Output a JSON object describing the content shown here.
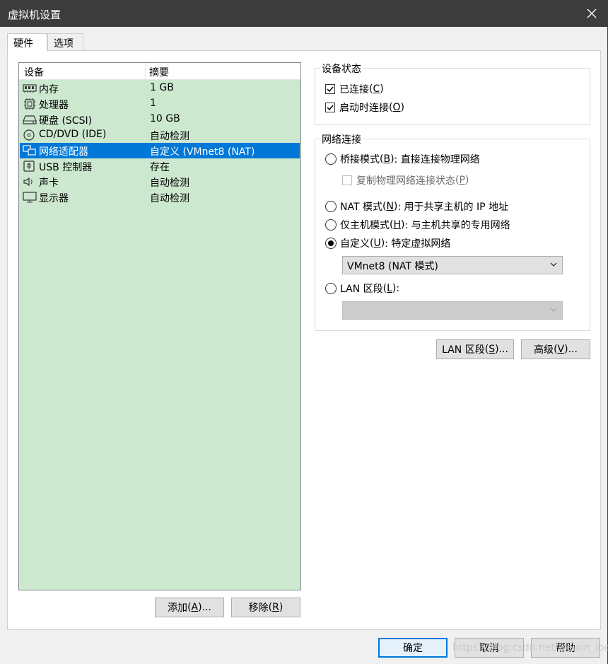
{
  "window": {
    "title": "虚拟机设置"
  },
  "tabs": [
    {
      "label": "硬件",
      "active": true
    },
    {
      "label": "选项",
      "active": false
    }
  ],
  "device_list": {
    "columns": [
      "设备",
      "摘要"
    ],
    "rows": [
      {
        "icon": "memory-icon",
        "name": "内存",
        "summary": "1 GB",
        "selected": false
      },
      {
        "icon": "processor-icon",
        "name": "处理器",
        "summary": "1",
        "selected": false
      },
      {
        "icon": "hard-disk-icon",
        "name": "硬盘 (SCSI)",
        "summary": "10 GB",
        "selected": false
      },
      {
        "icon": "cd-dvd-icon",
        "name": "CD/DVD (IDE)",
        "summary": "自动检测",
        "selected": false
      },
      {
        "icon": "network-adapter-icon",
        "name": "网络适配器",
        "summary": "自定义 (VMnet8 (NAT)",
        "selected": true
      },
      {
        "icon": "usb-icon",
        "name": "USB 控制器",
        "summary": "存在",
        "selected": false
      },
      {
        "icon": "sound-icon",
        "name": "声卡",
        "summary": "自动检测",
        "selected": false
      },
      {
        "icon": "display-icon",
        "name": "显示器",
        "summary": "自动检测",
        "selected": false
      }
    ],
    "add_button": {
      "label": "添加",
      "key": "A",
      "suffix": "..."
    },
    "remove_button": {
      "label": "移除",
      "key": "R",
      "suffix": ""
    }
  },
  "device_status": {
    "title": "设备状态",
    "connected": {
      "label": "已连接",
      "key": "C",
      "checked": true
    },
    "connect_at_power_on": {
      "label": "启动时连接",
      "key": "O",
      "checked": true
    }
  },
  "network_connection": {
    "title": "网络连接",
    "bridged": {
      "label": "桥接模式",
      "key": "B",
      "desc": ": 直接连接物理网络",
      "selected": false
    },
    "replicate": {
      "label": "复制物理网络连接状态",
      "key": "P",
      "checked": false,
      "disabled": true
    },
    "nat": {
      "label": "NAT 模式",
      "key": "N",
      "desc": ": 用于共享主机的 IP 地址",
      "selected": false
    },
    "host_only": {
      "label": "仅主机模式",
      "key": "H",
      "desc": ": 与主机共享的专用网络",
      "selected": false
    },
    "custom": {
      "label": "自定义",
      "key": "U",
      "desc": ": 特定虚拟网络",
      "selected": true
    },
    "custom_select_value": "VMnet8 (NAT 模式)",
    "lan_segment": {
      "label": "LAN 区段",
      "key": "L",
      "desc": ":",
      "selected": false
    },
    "lan_select_value": ""
  },
  "network_buttons": {
    "lan_segments": {
      "label": "LAN 区段",
      "key": "S",
      "suffix": "..."
    },
    "advanced": {
      "label": "高级",
      "key": "V",
      "suffix": "..."
    }
  },
  "footer": {
    "ok": "确定",
    "cancel": "取消",
    "help": "帮助"
  },
  "watermark": "https://blog.csdn.net/weixin_ibosifa"
}
